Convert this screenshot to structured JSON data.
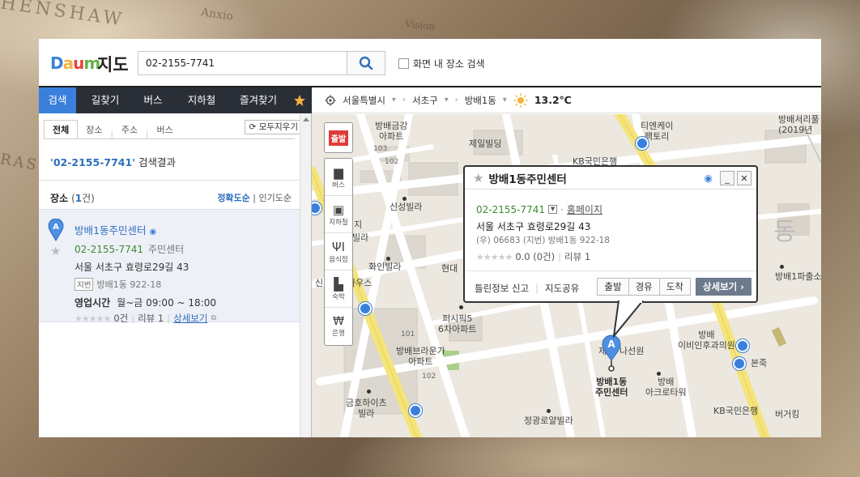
{
  "header": {
    "logo_parts": [
      "D",
      "a",
      "u",
      "m"
    ],
    "map_label": "지도",
    "search_value": "02-2155-7741",
    "checkbox_label": "화면 내 장소 검색"
  },
  "nav": {
    "tabs": [
      "검색",
      "길찾기",
      "버스",
      "지하철",
      "즐겨찾기"
    ]
  },
  "breadcrumb": {
    "city": "서울특별시",
    "district": "서초구",
    "dong": "방배1동",
    "temperature": "13.2℃"
  },
  "panel": {
    "subtabs": [
      "전체",
      "장소",
      "주소",
      "버스"
    ],
    "clear_all": "모두지우기",
    "result_query": "'02-2155-7741'",
    "result_suffix": " 검색결과",
    "section_title": "장소",
    "count_prefix": "(",
    "count": "1",
    "count_suffix": "건)",
    "sort_accuracy": "정확도순",
    "sort_popular": "인기도순",
    "item": {
      "name": "방배1동주민센터",
      "phone": "02-2155-7741",
      "category": "주민센터",
      "address": "서울 서초구 효령로29길 43",
      "jibun_badge": "지번",
      "jibun": "방배1동 922-18",
      "hours_label": "영업시간",
      "hours": "월~금 09:00 ~ 18:00",
      "rating_count": "0건",
      "review": "리뷰 1",
      "detail": "상세보기"
    }
  },
  "map_toolbar": {
    "start": "출발",
    "buttons": [
      "버스",
      "지하철",
      "음식점",
      "숙박",
      "은행"
    ]
  },
  "map_labels": {
    "bangbae_geumgang": "방배금강\n아파트",
    "n103": "103",
    "n102a": "102",
    "jeil": "제일빌딩",
    "kb_top": "KB국민은행",
    "tdon": "티엔케이\n팩토리",
    "bangbae_seorae": "방배서리풀\n(2019년",
    "sinsung": "신성빌라",
    "gong": "공",
    "ji": "지",
    "billa": "빌라",
    "hwain": "화인빌라",
    "hyundae": "현대",
    "sin_house": "신",
    "house": "하우스",
    "dong": "동",
    "pasu": "방배1파출소",
    "percy": "퍼시픽5\n6차아파트",
    "n101a": "101",
    "bangbae_brown": "방배브라운가\n아파트",
    "n102b": "102",
    "seon": "나선원",
    "je": "제",
    "center": "방배1동\n주민센터",
    "bangbae_clinic": "방배\n이비인후과의원",
    "acro": "방배\n아크로타워",
    "bonjuk": "본죽",
    "kb_bottom": "KB국민은행",
    "burger": "버거킹",
    "kumho": "금호하이츠\n빌라",
    "jungwang": "정광로얄빌라",
    "n101b": "101"
  },
  "info_window": {
    "name": "방배1동주민센터",
    "phone": "02-2155-7741",
    "homepage": "홈페이지",
    "address": "서울 서초구 효령로29길 43",
    "sub": "(우) 06683  (지번) 방배1동 922-18",
    "rating": "0.0 (0건)",
    "review": "리뷰 1",
    "report": "틀린정보 신고",
    "share": "지도공유",
    "btn_start": "출발",
    "btn_via": "경유",
    "btn_arrive": "도착",
    "btn_detail": "상세보기"
  },
  "background": {
    "word1": "HENSHAW",
    "word2": "Anxio",
    "word3": "Vision",
    "word4": "RAS"
  },
  "colors": {
    "accent": "#3a7fdc",
    "nav_dark": "#2a2f37",
    "phone_green": "#3a8a2f",
    "start_red": "#e03b3b"
  }
}
